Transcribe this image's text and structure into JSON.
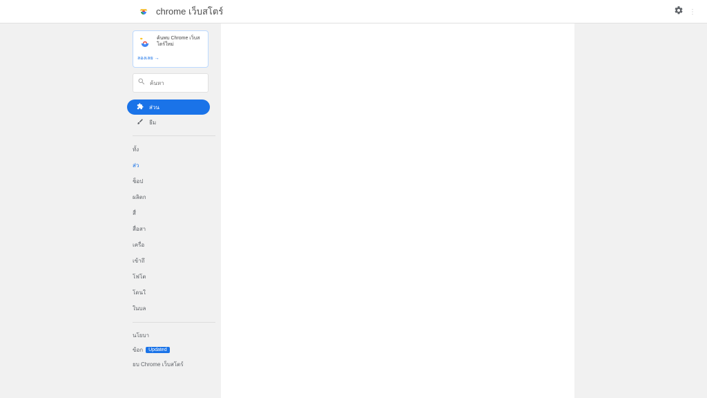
{
  "header": {
    "title": "chrome เว็บสโตร์",
    "signin": "⋮"
  },
  "promo": {
    "text1": "ค้นพบ Chrome เว็บส",
    "text2": "โตร์ใหม่",
    "link": "ลองเลย →"
  },
  "search": {
    "placeholder": "ค้นหา"
  },
  "tabs": {
    "extensions": "ส่วน",
    "themes": "ธีม"
  },
  "categories": [
    "ทั้ง",
    "ส่ว",
    "ช็อป",
    "ผลิตก",
    "สื่",
    "สื่อสา",
    "เครื่อ",
    "เข้าถึ",
    "โฟโต",
    "โดนใ",
    "ในบล"
  ],
  "selected_category_index": 1,
  "footer": {
    "privacy": "นโยบา",
    "terms_label": "ข้อก",
    "terms_badge": "Updated",
    "about": "ยบ Chrome เว็บสโตร์"
  }
}
